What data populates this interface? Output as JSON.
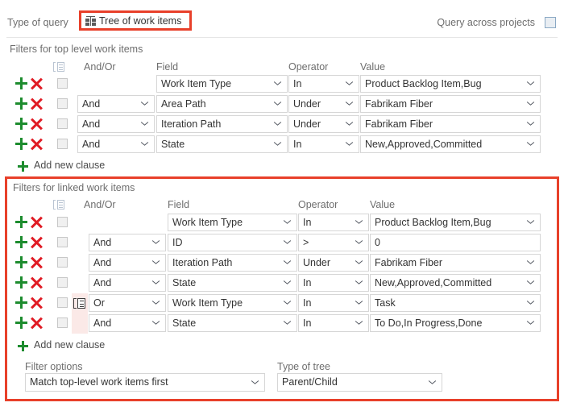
{
  "header": {
    "type_of_query_label": "Type of query",
    "query_type_value": "Tree of work items",
    "query_type_icon": "tree-of-work-items-icon",
    "query_across_projects_label": "Query across projects",
    "query_across_projects_checked": false
  },
  "accent_colors": {
    "highlight_red": "#e8402a",
    "add_green": "#1d8c2e",
    "delete_red": "#e01b24",
    "group_highlight": "#fbe9e7"
  },
  "top_level": {
    "section_title": "Filters for top level work items",
    "columns": {
      "group": "group-icon",
      "and_or": "And/Or",
      "field": "Field",
      "operator": "Operator",
      "value": "Value"
    },
    "rows": [
      {
        "and_or": "",
        "field": "Work Item Type",
        "operator": "In",
        "value": "Product Backlog Item,Bug",
        "value_is_dropdown": true,
        "grouped": false
      },
      {
        "and_or": "And",
        "field": "Area Path",
        "operator": "Under",
        "value": "Fabrikam Fiber",
        "value_is_dropdown": true,
        "grouped": false
      },
      {
        "and_or": "And",
        "field": "Iteration Path",
        "operator": "Under",
        "value": "Fabrikam Fiber",
        "value_is_dropdown": true,
        "grouped": false
      },
      {
        "and_or": "And",
        "field": "State",
        "operator": "In",
        "value": "New,Approved,Committed",
        "value_is_dropdown": true,
        "grouped": false
      }
    ],
    "add_new_clause_label": "Add new clause"
  },
  "linked": {
    "section_title": "Filters for linked work items",
    "columns": {
      "group": "group-icon",
      "and_or": "And/Or",
      "field": "Field",
      "operator": "Operator",
      "value": "Value"
    },
    "rows": [
      {
        "and_or": "",
        "field": "Work Item Type",
        "operator": "In",
        "value": "Product Backlog Item,Bug",
        "value_is_dropdown": true,
        "grouped": false
      },
      {
        "and_or": "And",
        "field": "ID",
        "operator": ">",
        "value": "0",
        "value_is_dropdown": false,
        "grouped": false
      },
      {
        "and_or": "And",
        "field": "Iteration Path",
        "operator": "Under",
        "value": "Fabrikam Fiber",
        "value_is_dropdown": true,
        "grouped": false
      },
      {
        "and_or": "And",
        "field": "State",
        "operator": "In",
        "value": "New,Approved,Committed",
        "value_is_dropdown": true,
        "grouped": false
      },
      {
        "and_or": "Or",
        "field": "Work Item Type",
        "operator": "In",
        "value": "Task",
        "value_is_dropdown": true,
        "grouped": true,
        "group_icon": true
      },
      {
        "and_or": "And",
        "field": "State",
        "operator": "In",
        "value": "To Do,In Progress,Done",
        "value_is_dropdown": true,
        "grouped": true,
        "group_icon": false
      }
    ],
    "add_new_clause_label": "Add new clause",
    "filter_options_label": "Filter options",
    "filter_options_value": "Match top-level work items first",
    "type_of_tree_label": "Type of tree",
    "type_of_tree_value": "Parent/Child"
  }
}
